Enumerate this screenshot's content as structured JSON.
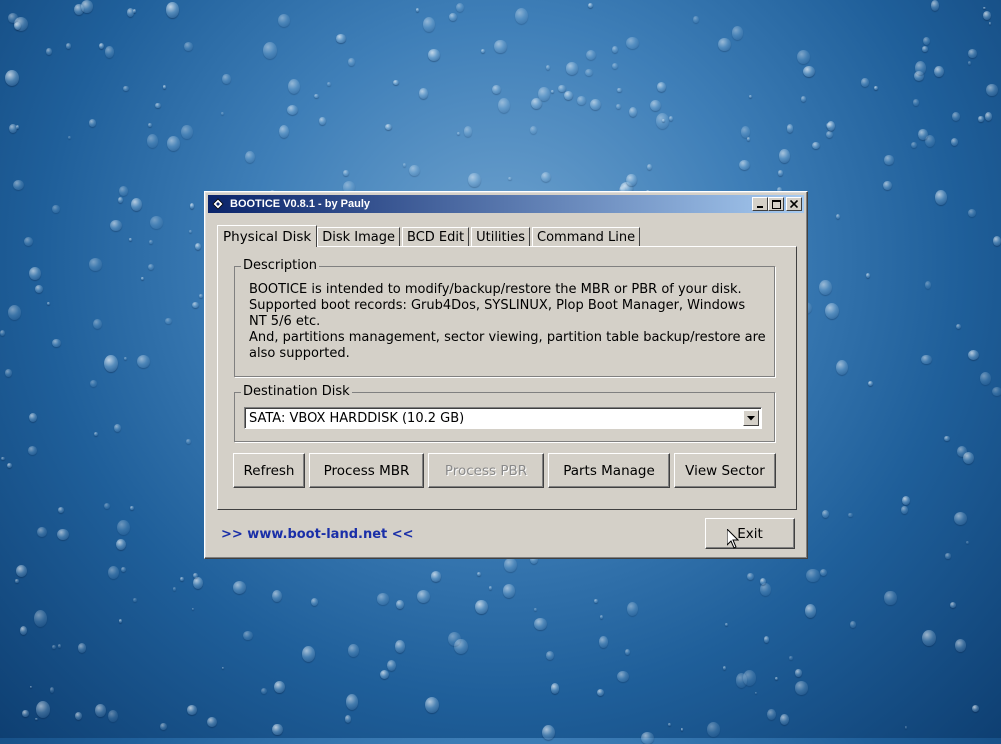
{
  "window": {
    "title": "BOOTICE V0.8.1 - by Pauly",
    "caption_buttons": {
      "minimize": "_",
      "maximize": "□",
      "close": "✕"
    }
  },
  "tabs": [
    {
      "label": "Physical Disk",
      "active": true
    },
    {
      "label": "Disk Image",
      "active": false
    },
    {
      "label": "BCD Edit",
      "active": false
    },
    {
      "label": "Utilities",
      "active": false
    },
    {
      "label": "Command Line",
      "active": false
    }
  ],
  "description": {
    "label": "Description",
    "lines": [
      "BOOTICE is intended to modify/backup/restore the MBR or PBR of your disk.",
      "Supported boot records: Grub4Dos, SYSLINUX, Plop Boot Manager, Windows",
      "NT 5/6 etc.",
      "And, partitions management, sector viewing, partition table backup/restore are",
      "also supported."
    ]
  },
  "destination": {
    "label": "Destination Disk",
    "selected": "SATA: VBOX HARDDISK (10.2 GB)"
  },
  "buttons": {
    "refresh": "Refresh",
    "process_mbr": "Process MBR",
    "process_pbr": "Process PBR",
    "parts_manage": "Parts Manage",
    "view_sector": "View Sector",
    "exit": "Exit"
  },
  "footer": {
    "link": ">> www.boot-land.net <<"
  },
  "colors": {
    "titlebar_start": "#0a246a",
    "titlebar_end": "#a6caf0",
    "window_face": "#d4d0c8",
    "link": "#1a2fa8"
  },
  "icons": {
    "app": "bootice-app-icon",
    "dropdown": "chevron-down-icon",
    "cursor": "mouse-pointer-icon"
  }
}
